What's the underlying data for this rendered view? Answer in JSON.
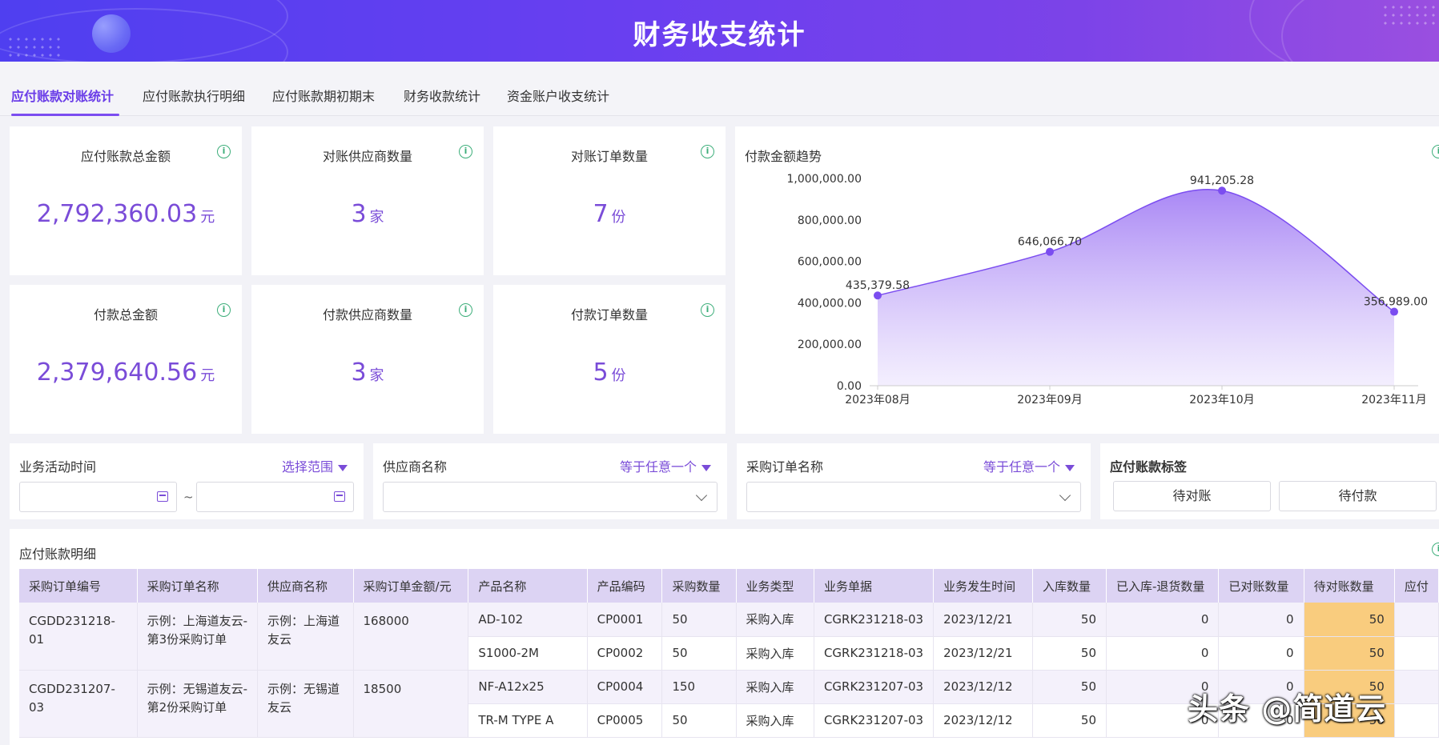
{
  "header": {
    "title": "财务收支统计"
  },
  "tabs": [
    {
      "label": "应付账款对账统计"
    },
    {
      "label": "应付账款执行明细"
    },
    {
      "label": "应付账款期初期末"
    },
    {
      "label": "财务收款统计"
    },
    {
      "label": "资金账户收支统计"
    }
  ],
  "kpis": [
    {
      "title": "应付账款总金额",
      "value": "2,792,360.03",
      "unit": "元"
    },
    {
      "title": "对账供应商数量",
      "value": "3",
      "unit": "家"
    },
    {
      "title": "对账订单数量",
      "value": "7",
      "unit": "份"
    },
    {
      "title": "付款总金额",
      "value": "2,379,640.56",
      "unit": "元"
    },
    {
      "title": "付款供应商数量",
      "value": "3",
      "unit": "家"
    },
    {
      "title": "付款订单数量",
      "value": "5",
      "unit": "份"
    }
  ],
  "chart_data": {
    "type": "area",
    "title": "付款金额趋势",
    "categories": [
      "2023年08月",
      "2023年09月",
      "2023年10月",
      "2023年11月"
    ],
    "values": [
      435379.58,
      646066.7,
      941205.28,
      356989.0
    ],
    "data_labels": [
      "435,379.58",
      "646,066.70",
      "941,205.28",
      "356,989.00"
    ],
    "yticks": [
      "0.00",
      "200,000.00",
      "400,000.00",
      "600,000.00",
      "800,000.00",
      "1,000,000.00"
    ],
    "ylim": [
      0,
      1000000
    ],
    "color": "#7b4df0",
    "grid": false
  },
  "filters": {
    "time": {
      "label": "业务活动时间",
      "op": "选择范围",
      "sep": "~"
    },
    "supplier": {
      "label": "供应商名称",
      "op": "等于任意一个"
    },
    "order": {
      "label": "采购订单名称",
      "op": "等于任意一个"
    },
    "tags": {
      "label": "应付账款标签",
      "buttons": [
        "待对账",
        "待付款"
      ]
    }
  },
  "table": {
    "title": "应付账款明细",
    "headers": [
      "采购订单编号",
      "采购订单名称",
      "供应商名称",
      "采购订单金额/元",
      "产品名称",
      "产品编码",
      "采购数量",
      "业务类型",
      "业务单据",
      "业务发生时间",
      "入库数量",
      "已入库-退货数量",
      "已对账数量",
      "待对账数量",
      "应付"
    ],
    "groups": [
      {
        "order_no": "CGDD231218-01",
        "order_name": "示例：上海道友云-第3份采购订单",
        "supplier": "示例：上海道友云",
        "amount": "168000",
        "rows": [
          {
            "product": "AD-102",
            "code": "CP0001",
            "qty": "50",
            "type": "采购入库",
            "doc": "CGRK231218-03",
            "date": "2023/12/21",
            "in": "50",
            "ret": "0",
            "rec": "0",
            "pend": "50"
          },
          {
            "product": "S1000-2M",
            "code": "CP0002",
            "qty": "50",
            "type": "采购入库",
            "doc": "CGRK231218-03",
            "date": "2023/12/21",
            "in": "50",
            "ret": "0",
            "rec": "0",
            "pend": "50"
          }
        ]
      },
      {
        "order_no": "CGDD231207-03",
        "order_name": "示例：无锡道友云-第2份采购订单",
        "supplier": "示例：无锡道友云",
        "amount": "18500",
        "rows": [
          {
            "product": "NF-A12x25",
            "code": "CP0004",
            "qty": "150",
            "type": "采购入库",
            "doc": "CGRK231207-03",
            "date": "2023/12/12",
            "in": "50",
            "ret": "0",
            "rec": "0",
            "pend": "50"
          },
          {
            "product": "TR-M TYPE A",
            "code": "CP0005",
            "qty": "50",
            "type": "采购入库",
            "doc": "CGRK231207-03",
            "date": "2023/12/12",
            "in": "50",
            "ret": "0",
            "rec": "0",
            "pend": "50"
          }
        ]
      }
    ]
  },
  "watermark": "头条 @简道云"
}
